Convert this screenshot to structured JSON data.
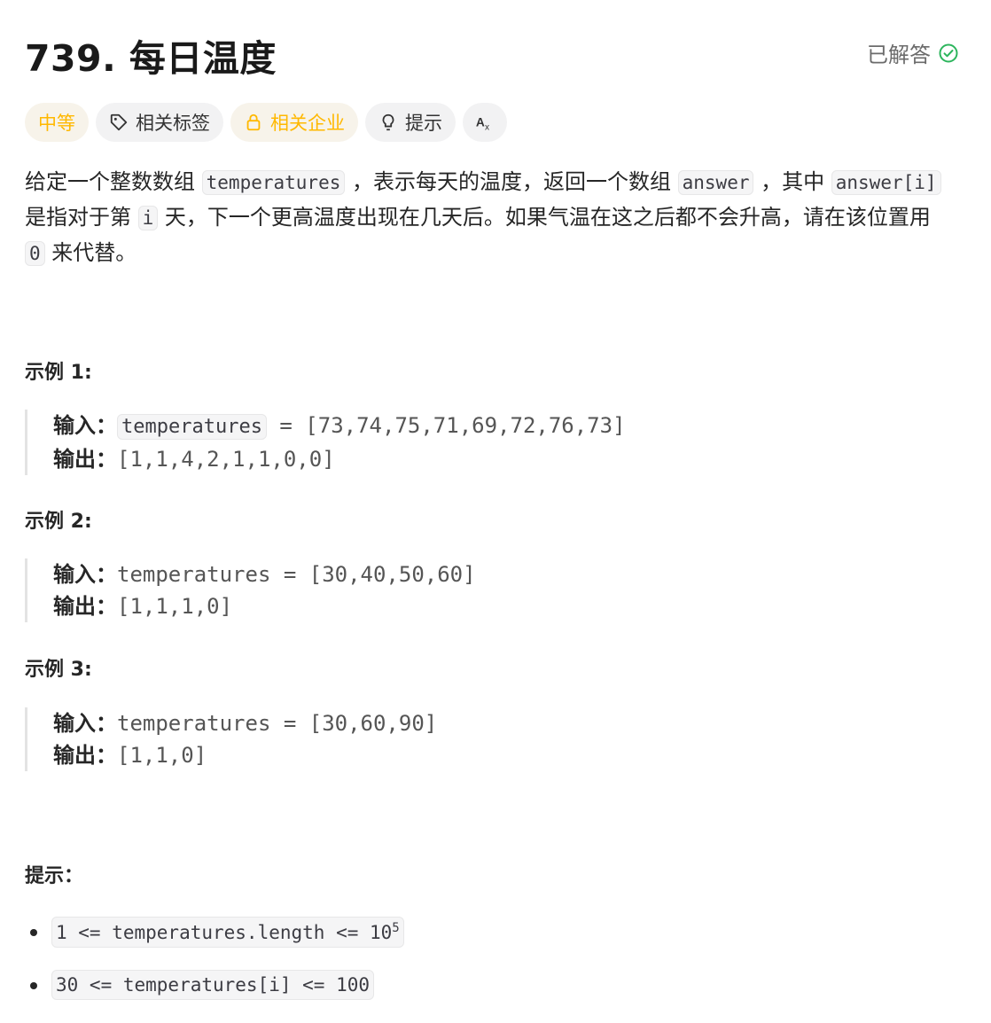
{
  "problem": {
    "title": "739. 每日温度",
    "status": "已解答"
  },
  "tags": {
    "difficulty": "中等",
    "related_tags": "相关标签",
    "related_companies": "相关企业",
    "hint": "提示",
    "translate_icon": "translate-icon"
  },
  "description": {
    "p1": "给定一个整数数组 ",
    "code1": "temperatures",
    "p2": " ，表示每天的温度，返回一个数组 ",
    "code2": "answer",
    "p3": " ，其中 ",
    "code3": "answer[i]",
    "p4": " 是指对于第 ",
    "code4": "i",
    "p5": " 天，下一个更高温度出现在几天后。如果气温在这之后都不会升高，请在该位置用 ",
    "code5": "0",
    "p6": " 来代替。"
  },
  "examples": [
    {
      "title": "示例 1:",
      "input_label": "输入：",
      "input_var": "temperatures",
      "input_rest": " = [73,74,75,71,69,72,76,73]",
      "output_label": "输出：",
      "output": "[1,1,4,2,1,1,0,0]"
    },
    {
      "title": "示例 2:",
      "input_label": "输入：",
      "input": "temperatures = [30,40,50,60]",
      "output_label": "输出：",
      "output": "[1,1,1,0]"
    },
    {
      "title": "示例 3:",
      "input_label": "输入：",
      "input": "temperatures = [30,60,90]",
      "output_label": "输出：",
      "output": "[1,1,0]"
    }
  ],
  "hints": {
    "title": "提示：",
    "c1_base": "1 <= temperatures.length <= 10",
    "c1_sup": "5",
    "c2": "30 <= temperatures[i] <= 100"
  },
  "colors": {
    "difficulty": "#ffb800",
    "solved": "#2db55d"
  }
}
